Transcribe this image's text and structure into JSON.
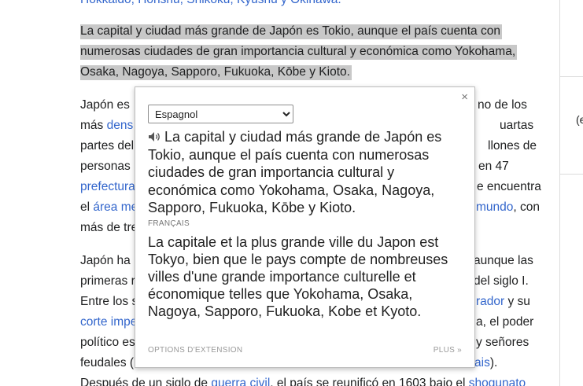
{
  "article": {
    "top_line": "Hokkaidō, Honshū, Shikoku, Kyūshū y Okinawa.",
    "selected": [
      "La capital y ciudad más grande de Japón es Tokio, aunque el país cuenta con",
      "numerosas ciudades de gran importancia cultural y económica como Yokohama,",
      "Osaka, Nagoya, Sapporo, Fukuoka, Kōbe y Kioto."
    ],
    "p2": {
      "l1_left": "Japón es",
      "l1_right": "no de los",
      "l2_left": "más",
      "l2_link": "dens",
      "l2_right": "uartas",
      "l3_left": "partes del",
      "l3_right": "llones de",
      "l4_left": "personas",
      "l4_right": "en 47",
      "l5_link": "prefectura",
      "l5_right": "e encuentra",
      "l6_left": "el",
      "l6_link": "área me",
      "l6_link_right": "mundo",
      "l6_right": ", con",
      "l7_left": "más de tre"
    },
    "p3": {
      "l1_left": "Japón ha",
      "l1_right": "aunque las",
      "l2_left": "primeras r",
      "l2_right": "del siglo I.",
      "l3_left": "Entre los s",
      "l3_link": "rador",
      "l3_right": "y su",
      "l4_link": "corte impe",
      "l4_right": "a, el poder",
      "l5_left": "político es",
      "l5_right": "y señores",
      "l6_left": "feudales (",
      "l6_link": "ais",
      "l6_right": ")."
    },
    "bottom": {
      "left": "Después de un siglo de",
      "link1": "guerra civil",
      "mid": ", el país se reunificó en 1603 bajo el",
      "link2": "shogunato"
    }
  },
  "sidebar": {
    "fragment": "(e"
  },
  "popup": {
    "close_label": "×",
    "language_selected": "Espagnol",
    "source_text": "La capital y ciudad más grande de Japón es Tokio, aunque el país cuenta con numerosas ciudades de gran importancia cultural y económica como Yokohama, Osaka, Nagoya, Sapporo, Fukuoka, Kōbe y Kioto.",
    "target_language": "FRANÇAIS",
    "translation": "La capitale et la plus grande ville du Japon est Tokyo, bien que le pays compte de nombreuses villes d'une grande importance culturelle et économique telles que Yokohama, Osaka, Nagoya, Sapporo, Fukuoka, Kobe et Kyoto.",
    "options_label": "OPTIONS D'EXTENSION",
    "more_label": "PLUS »"
  },
  "colors": {
    "link": "#3366cc",
    "selection": "#c8c8c8",
    "text": "#202122"
  },
  "icons": {
    "speaker": "speaker-icon",
    "close": "close-icon"
  }
}
